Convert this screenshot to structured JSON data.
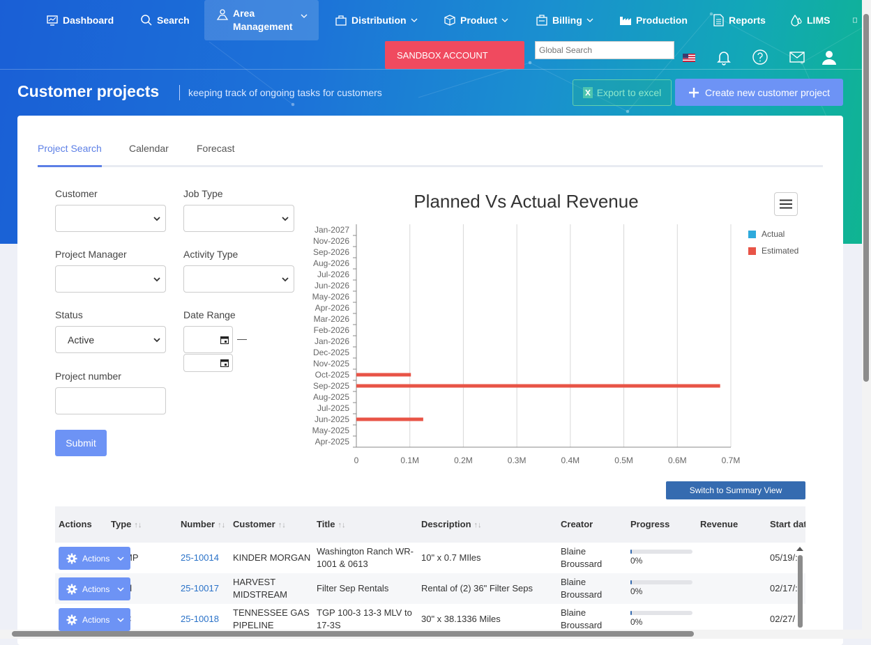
{
  "nav": {
    "items": [
      {
        "label": "Dashboard",
        "icon": "dashboard-icon",
        "dropdown": false
      },
      {
        "label": "Search",
        "icon": "search-icon",
        "dropdown": false
      },
      {
        "label": "Area Management",
        "icon": "area-management-icon",
        "dropdown": true
      },
      {
        "label": "Distribution",
        "icon": "bag-icon",
        "dropdown": true
      },
      {
        "label": "Product",
        "icon": "box-icon",
        "dropdown": true
      },
      {
        "label": "Billing",
        "icon": "billing-icon",
        "dropdown": true
      },
      {
        "label": "Production",
        "icon": "factory-icon",
        "dropdown": false
      },
      {
        "label": "Reports",
        "icon": "report-icon",
        "dropdown": false
      },
      {
        "label": "LIMS",
        "icon": "drops-icon",
        "dropdown": false
      }
    ],
    "area_line1": "Area",
    "area_line2": "Management"
  },
  "header": {
    "sandbox_label": "SANDBOX ACCOUNT",
    "global_search_placeholder": "Global Search"
  },
  "page": {
    "title": "Customer projects",
    "subtitle": "keeping track of ongoing tasks for customers",
    "export_label": "Export to excel",
    "create_label": "Create new customer project"
  },
  "tabs": [
    {
      "label": "Project Search",
      "active": true
    },
    {
      "label": "Calendar",
      "active": false
    },
    {
      "label": "Forecast",
      "active": false
    }
  ],
  "filters": {
    "customer_label": "Customer",
    "job_type_label": "Job Type",
    "project_manager_label": "Project Manager",
    "activity_type_label": "Activity Type",
    "status_label": "Status",
    "status_value": "Active",
    "date_range_label": "Date Range",
    "date_range_separator": "—",
    "project_number_label": "Project number",
    "submit_label": "Submit"
  },
  "chart_data": {
    "type": "bar",
    "orientation": "horizontal",
    "title": "Planned Vs Actual Revenue",
    "categories": [
      "Apr-2025",
      "May-2025",
      "Jun-2025",
      "Jul-2025",
      "Aug-2025",
      "Sep-2025",
      "Oct-2025",
      "Nov-2025",
      "Dec-2025",
      "Jan-2026",
      "Feb-2026",
      "Mar-2026",
      "Apr-2026",
      "May-2026",
      "Jun-2026",
      "Jul-2026",
      "Aug-2026",
      "Sep-2026",
      "Nov-2026",
      "Jan-2027"
    ],
    "series": [
      {
        "name": "Actual",
        "color": "#2eaadc",
        "values": [
          0,
          0,
          0,
          0,
          0,
          0,
          0,
          0,
          0,
          0,
          0,
          0,
          0,
          0,
          0,
          0,
          0,
          0,
          0,
          0
        ]
      },
      {
        "name": "Estimated",
        "color": "#e85447",
        "values": [
          0,
          0,
          125000,
          0,
          0,
          680000,
          102000,
          0,
          0,
          0,
          0,
          0,
          0,
          0,
          0,
          0,
          0,
          0,
          0,
          0
        ]
      }
    ],
    "xticks": [
      "0",
      "0.1M",
      "0.2M",
      "0.3M",
      "0.4M",
      "0.5M",
      "0.6M",
      "0.7M"
    ],
    "xlim": [
      0,
      700000
    ],
    "grid": true,
    "legend_position": "top-right"
  },
  "table": {
    "switch_label": "Switch to Summary View",
    "columns": [
      {
        "label": "Actions",
        "sortable": false
      },
      {
        "label": "Type",
        "sortable": true
      },
      {
        "label": "Number",
        "sortable": true
      },
      {
        "label": "Customer",
        "sortable": true
      },
      {
        "label": "Title",
        "sortable": true
      },
      {
        "label": "Description",
        "sortable": true
      },
      {
        "label": "Creator",
        "sortable": false
      },
      {
        "label": "Progress",
        "sortable": false
      },
      {
        "label": "Revenue",
        "sortable": false
      },
      {
        "label": "Start dat",
        "sortable": false
      }
    ],
    "action_label": "Actions",
    "rows": [
      {
        "type": "MP",
        "number": "25-10014",
        "customer": "KINDER MORGAN",
        "title": "Washington Ranch WR-1001 & 0613",
        "description": "10\" x 0.7 MIles",
        "creator": "Blaine Broussard",
        "progress": 0.02,
        "progress_text": "0%",
        "revenue": "",
        "start": "05/19/:"
      },
      {
        "type": "al",
        "number": "25-10017",
        "customer": "HARVEST MIDSTREAM",
        "title": "Filter Sep Rentals",
        "description": "Rental of (2) 36\" Filter Seps",
        "creator": "Blaine Broussard",
        "progress": 0.02,
        "progress_text": "0%",
        "revenue": "",
        "start": "02/17/:"
      },
      {
        "type": "C",
        "number": "25-10018",
        "customer": "TENNESSEE GAS PIPELINE",
        "title": "TGP 100-3 13-3 MLV to 17-3S",
        "description": "30\" x 38.1336 Miles",
        "creator": "Blaine Broussard",
        "progress": 0.02,
        "progress_text": "0%",
        "revenue": "",
        "start": "02/27/"
      }
    ]
  }
}
